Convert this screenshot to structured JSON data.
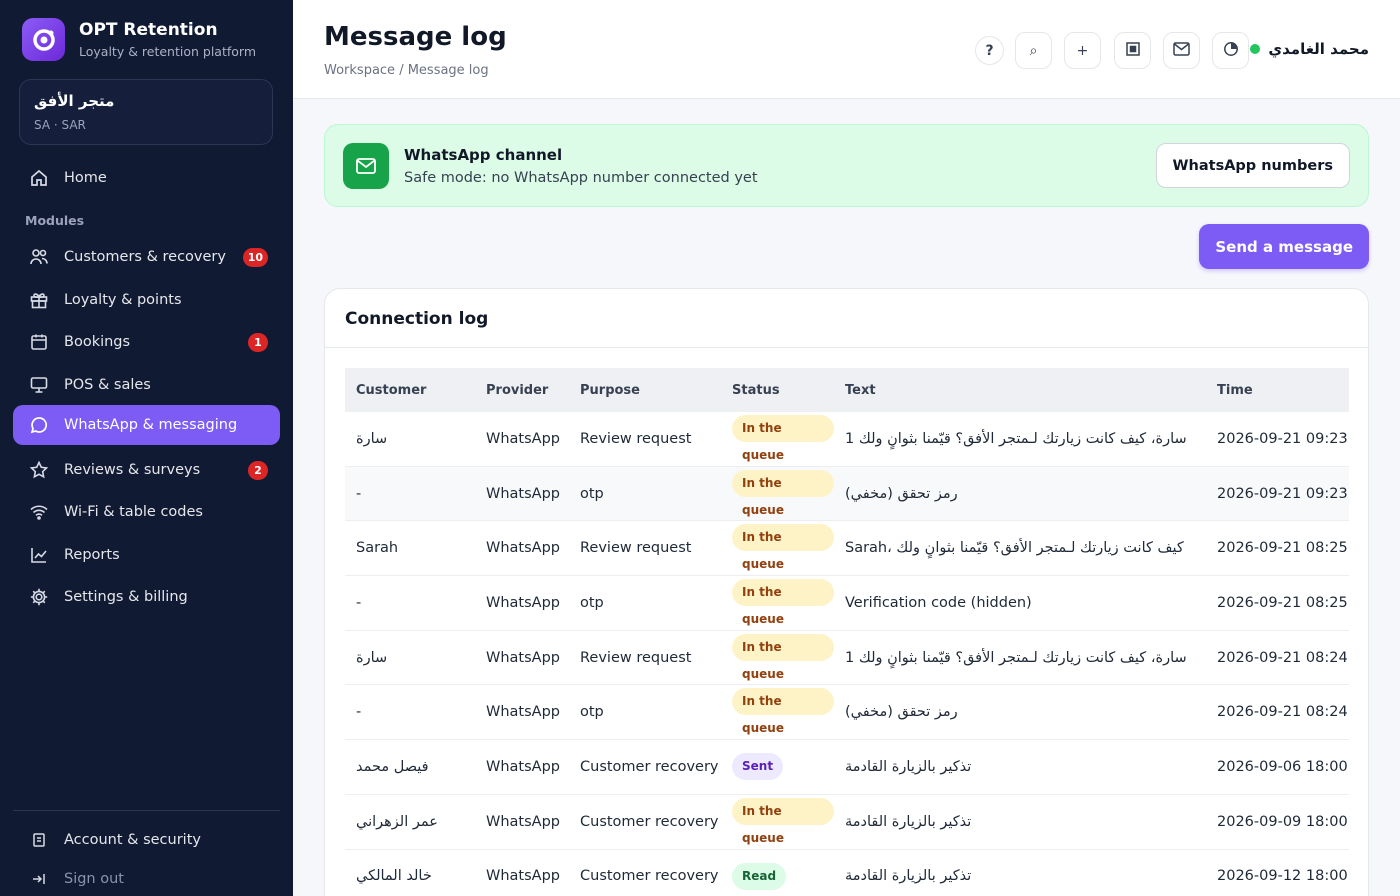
{
  "brand": {
    "title": "OPT Retention",
    "subtitle": "Loyalty & retention platform"
  },
  "store": {
    "name": "متجر الأفق",
    "meta": "SA · SAR"
  },
  "nav": {
    "home": "Home",
    "modules_label": "Modules",
    "items": [
      {
        "label": "Customers & recovery",
        "badge": "10",
        "icon": "users-icon"
      },
      {
        "label": "Loyalty & points",
        "badge": "",
        "icon": "gift-icon"
      },
      {
        "label": "Bookings",
        "badge": "1",
        "icon": "calendar-icon"
      },
      {
        "label": "POS & sales",
        "badge": "",
        "icon": "monitor-icon"
      },
      {
        "label": "WhatsApp & messaging",
        "badge": "",
        "icon": "chat-icon"
      },
      {
        "label": "Reviews & surveys",
        "badge": "2",
        "icon": "star-icon"
      },
      {
        "label": "Wi-Fi & table codes",
        "badge": "",
        "icon": "wifi-icon"
      },
      {
        "label": "Reports",
        "badge": "",
        "icon": "chart-icon"
      },
      {
        "label": "Settings & billing",
        "badge": "",
        "icon": "gear-icon"
      }
    ],
    "account": "Account & security",
    "signout": "Sign out"
  },
  "header": {
    "title": "Message log",
    "breadcrumb": "Workspace / Message log",
    "help_label": "?",
    "search_label": "⌕",
    "add_label": "+",
    "user_name": "محمد الغامدي"
  },
  "banner": {
    "title": "WhatsApp channel",
    "subtitle": "Safe mode: no WhatsApp number connected yet",
    "button": "WhatsApp numbers"
  },
  "send_button": "Send a message",
  "log": {
    "title": "Connection log",
    "columns": [
      "Customer",
      "Provider",
      "Purpose",
      "Status",
      "Text",
      "Time"
    ],
    "rows": [
      {
        "customer": "سارة",
        "provider": "WhatsApp",
        "purpose": "Review request",
        "status": "In the queue",
        "status_type": "queue",
        "text": "سارة، كيف كانت زيارتك لـمتجر الأفق؟ قيّمنا بثوانٍ ولك 1",
        "time": "2026-09-21 09:23"
      },
      {
        "customer": "-",
        "provider": "WhatsApp",
        "purpose": "otp",
        "status": "In the queue",
        "status_type": "queue",
        "text": "رمز تحقق (مخفي)",
        "time": "2026-09-21 09:23"
      },
      {
        "customer": "Sarah",
        "provider": "WhatsApp",
        "purpose": "Review request",
        "status": "In the queue",
        "status_type": "queue",
        "text": "Sarah، كيف كانت زيارتك لـمتجر الأفق؟ قيّمنا بثوانٍ ولك",
        "time": "2026-09-21 08:25"
      },
      {
        "customer": "-",
        "provider": "WhatsApp",
        "purpose": "otp",
        "status": "In the queue",
        "status_type": "queue",
        "text": "Verification code (hidden)",
        "time": "2026-09-21 08:25"
      },
      {
        "customer": "سارة",
        "provider": "WhatsApp",
        "purpose": "Review request",
        "status": "In the queue",
        "status_type": "queue",
        "text": "سارة، كيف كانت زيارتك لـمتجر الأفق؟ قيّمنا بثوانٍ ولك 1",
        "time": "2026-09-21 08:24"
      },
      {
        "customer": "-",
        "provider": "WhatsApp",
        "purpose": "otp",
        "status": "In the queue",
        "status_type": "queue",
        "text": "رمز تحقق (مخفي)",
        "time": "2026-09-21 08:24"
      },
      {
        "customer": "فيصل محمد",
        "provider": "WhatsApp",
        "purpose": "Customer recovery",
        "status": "Sent",
        "status_type": "sent",
        "text": "تذكير بالزيارة القادمة",
        "time": "2026-09-06 18:00"
      },
      {
        "customer": "عمر الزهراني",
        "provider": "WhatsApp",
        "purpose": "Customer recovery",
        "status": "In the queue",
        "status_type": "queue",
        "text": "تذكير بالزيارة القادمة",
        "time": "2026-09-09 18:00"
      },
      {
        "customer": "خالد المالكي",
        "provider": "WhatsApp",
        "purpose": "Customer recovery",
        "status": "Read",
        "status_type": "read",
        "text": "تذكير بالزيارة القادمة",
        "time": "2026-09-12 18:00"
      }
    ]
  }
}
